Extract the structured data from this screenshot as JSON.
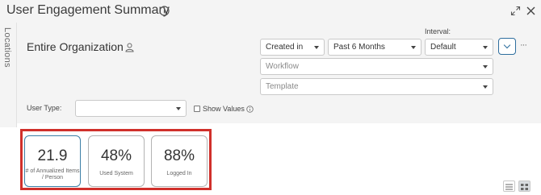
{
  "header": {
    "title": "User Engagement Summary",
    "icons": [
      "info-icon",
      "expand-icon",
      "close-icon"
    ]
  },
  "sidebar": {
    "label": "Locations"
  },
  "filters": {
    "org_name": "Entire Organization",
    "date_field": "Created in",
    "period": "Past 6 Months",
    "interval_label": "Interval:",
    "interval": "Default",
    "workflow_placeholder": "Workflow",
    "template_placeholder": "Template",
    "user_type_label": "User Type:",
    "user_type_value": "",
    "show_values_label": "Show Values",
    "show_values_checked": false
  },
  "metrics": [
    {
      "value": "21.9",
      "label": "# of Annualized Items / Person"
    },
    {
      "value": "48%",
      "label": "Used System"
    },
    {
      "value": "88%",
      "label": "Logged In"
    }
  ],
  "colors": {
    "highlight": "#d0302b",
    "accent": "#2e6e9e",
    "panel_bg": "#f4f4f4"
  }
}
